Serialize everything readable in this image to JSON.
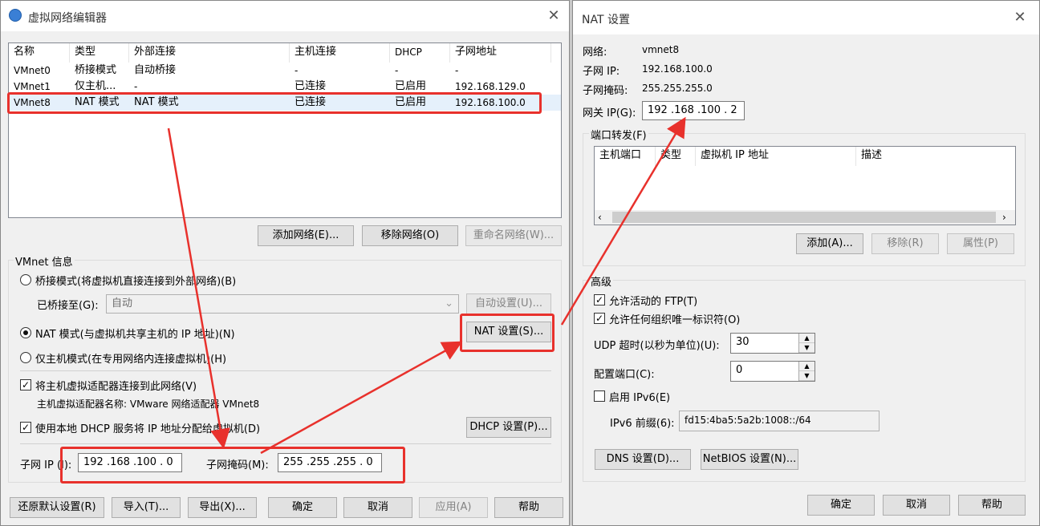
{
  "left": {
    "title": "虚拟网络编辑器",
    "close": "✕",
    "columns": [
      "名称",
      "类型",
      "外部连接",
      "主机连接",
      "DHCP",
      "子网地址"
    ],
    "rows": [
      [
        "VMnet0",
        "桥接模式",
        "自动桥接",
        "-",
        "-",
        "-"
      ],
      [
        "VMnet1",
        "仅主机...",
        "-",
        "已连接",
        "已启用",
        "192.168.129.0"
      ],
      [
        "VMnet8",
        "NAT 模式",
        "NAT 模式",
        "已连接",
        "已启用",
        "192.168.100.0"
      ]
    ],
    "add_network": "添加网络(E)...",
    "remove_network": "移除网络(O)",
    "rename_network": "重命名网络(W)...",
    "vmnet_info": "VMnet 信息",
    "bridge_mode": "桥接模式(将虚拟机直接连接到外部网络)(B)",
    "bridged_to_label": "已桥接至(G):",
    "bridged_to_value": "自动",
    "auto_settings": "自动设置(U)...",
    "nat_mode": "NAT 模式(与虚拟机共享主机的 IP 地址)(N)",
    "nat_settings": "NAT 设置(S)...",
    "host_only": "仅主机模式(在专用网络内连接虚拟机)(H)",
    "connect_adapter": "将主机虚拟适配器连接到此网络(V)",
    "adapter_name": "主机虚拟适配器名称: VMware 网络适配器 VMnet8",
    "use_dhcp": "使用本地 DHCP 服务将 IP 地址分配给虚拟机(D)",
    "dhcp_settings": "DHCP 设置(P)...",
    "subnet_ip_label": "子网 IP (I):",
    "subnet_ip_value": "192 .168 .100 .  0",
    "subnet_mask_label": "子网掩码(M):",
    "subnet_mask_value": "255 .255 .255 .  0",
    "restore": "还原默认设置(R)",
    "import": "导入(T)...",
    "export": "导出(X)...",
    "ok": "确定",
    "cancel": "取消",
    "apply": "应用(A)",
    "help": "帮助"
  },
  "right": {
    "title": "NAT 设置",
    "close": "✕",
    "network_label": "网络:",
    "network_value": "vmnet8",
    "subnet_ip_label": "子网 IP:",
    "subnet_ip_value": "192.168.100.0",
    "subnet_mask_label": "子网掩码:",
    "subnet_mask_value": "255.255.255.0",
    "gateway_label": "网关 IP(G):",
    "gateway_value": "192 .168 .100 .  2",
    "port_forward": "端口转发(F)",
    "pf_columns": [
      "主机端口",
      "类型",
      "虚拟机 IP 地址",
      "描述"
    ],
    "pf_add": "添加(A)...",
    "pf_remove": "移除(R)",
    "pf_props": "属性(P)",
    "advanced": "高级",
    "allow_ftp": "允许活动的 FTP(T)",
    "allow_oui": "允许任何组织唯一标识符(O)",
    "udp_label": "UDP 超时(以秒为单位)(U):",
    "udp_value": "30",
    "config_port_label": "配置端口(C):",
    "config_port_value": "0",
    "enable_ipv6": "启用 IPv6(E)",
    "ipv6_prefix_label": "IPv6 前缀(6):",
    "ipv6_prefix_value": "fd15:4ba5:5a2b:1008::/64",
    "dns": "DNS 设置(D)...",
    "netbios": "NetBIOS 设置(N)...",
    "ok": "确定",
    "cancel": "取消",
    "help": "帮助"
  },
  "colors": {
    "highlight": "#e8312c",
    "arrow": "#e8312c"
  }
}
